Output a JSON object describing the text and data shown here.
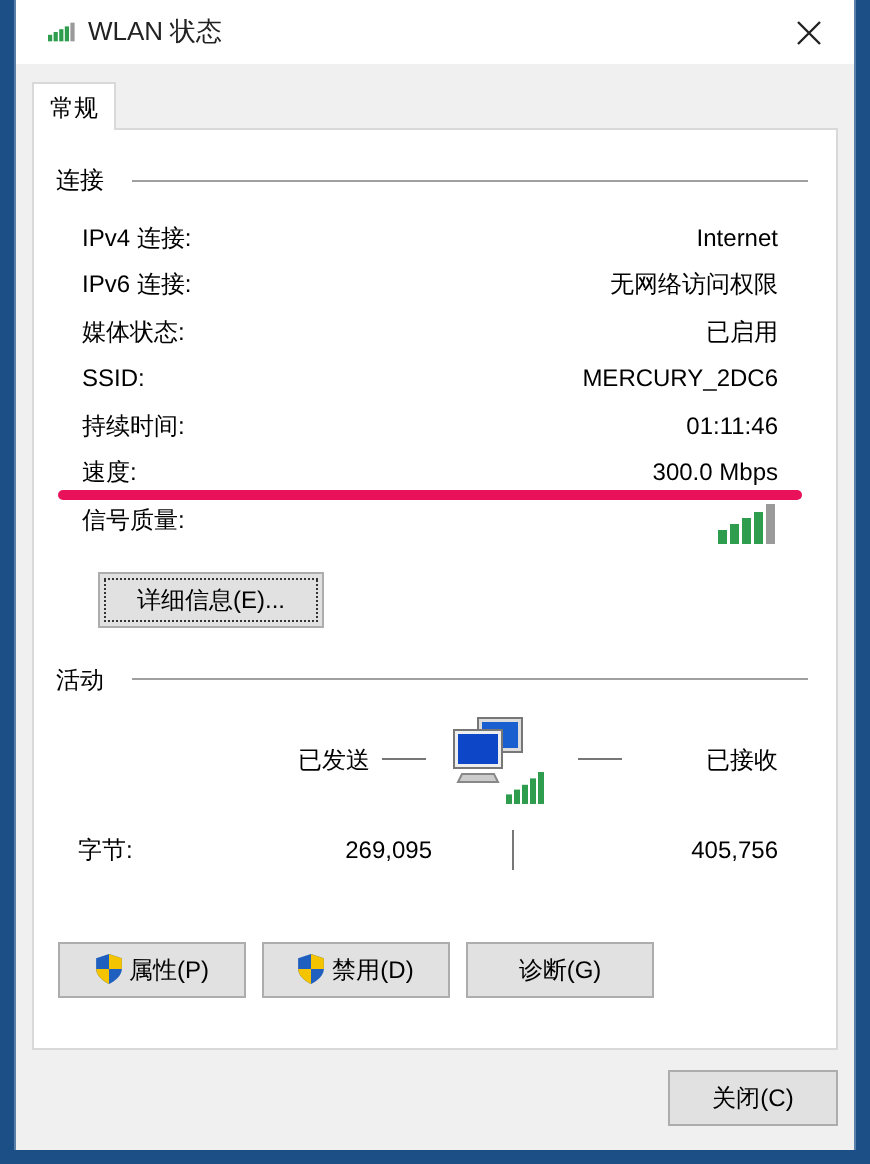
{
  "window": {
    "title": "WLAN 状态"
  },
  "tabs": [
    {
      "label": "常规",
      "selected": true
    }
  ],
  "connection": {
    "heading": "连接",
    "rows": [
      {
        "label": "IPv4 连接:",
        "value": "Internet",
        "kind": "text"
      },
      {
        "label": "IPv6 连接:",
        "value": "无网络访问权限",
        "kind": "text"
      },
      {
        "label": "媒体状态:",
        "value": "已启用",
        "kind": "text"
      },
      {
        "label": "SSID:",
        "value": "MERCURY_2DC6",
        "kind": "text"
      },
      {
        "label": "持续时间:",
        "value": "01:11:46",
        "kind": "text"
      },
      {
        "label": "速度:",
        "value": "300.0 Mbps",
        "kind": "text",
        "highlighted": true
      },
      {
        "label": "信号质量:",
        "kind": "signal"
      }
    ],
    "details_button": "详细信息(E)..."
  },
  "activity": {
    "heading": "活动",
    "sent_label": "已发送",
    "received_label": "已接收",
    "bytes_label": "字节:",
    "sent": "269,095",
    "received": "405,756"
  },
  "buttons": [
    {
      "label": "属性(P)",
      "shield": true
    },
    {
      "label": "禁用(D)",
      "shield": true
    },
    {
      "label": "诊断(G)",
      "shield": false
    }
  ],
  "close_button": "关闭(C)"
}
